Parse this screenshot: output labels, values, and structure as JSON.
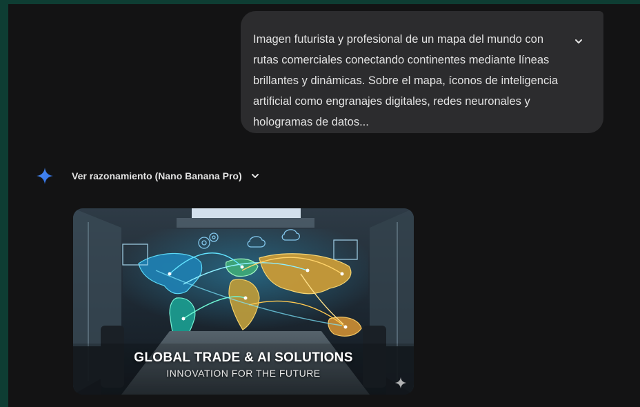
{
  "prompt": {
    "text": "Imagen futurista y profesional de un mapa del mundo con rutas comerciales conectando continentes mediante líneas brillantes y dinámicas. Sobre el mapa, íconos de inteligencia artificial como engranajes digitales, redes neuronales y hologramas de datos...",
    "collapse_icon": "chevron-down-icon"
  },
  "response": {
    "model_icon": "sparkle-icon",
    "reasoning_label": "Ver razonamiento (Nano Banana Pro)",
    "reasoning_toggle_icon": "chevron-down-icon"
  },
  "image": {
    "title": "GLOBAL TRADE & AI SOLUTIONS",
    "subtitle": "INNOVATION FOR THE FUTURE",
    "watermark_icon": "sparkle-icon"
  },
  "colors": {
    "frame": "#0e3d33",
    "background": "#131314",
    "bubble": "#2c2c2e",
    "accent": "#4c8df6",
    "map_glow_cyan": "#39d3ff",
    "map_glow_gold": "#f2c14e"
  }
}
